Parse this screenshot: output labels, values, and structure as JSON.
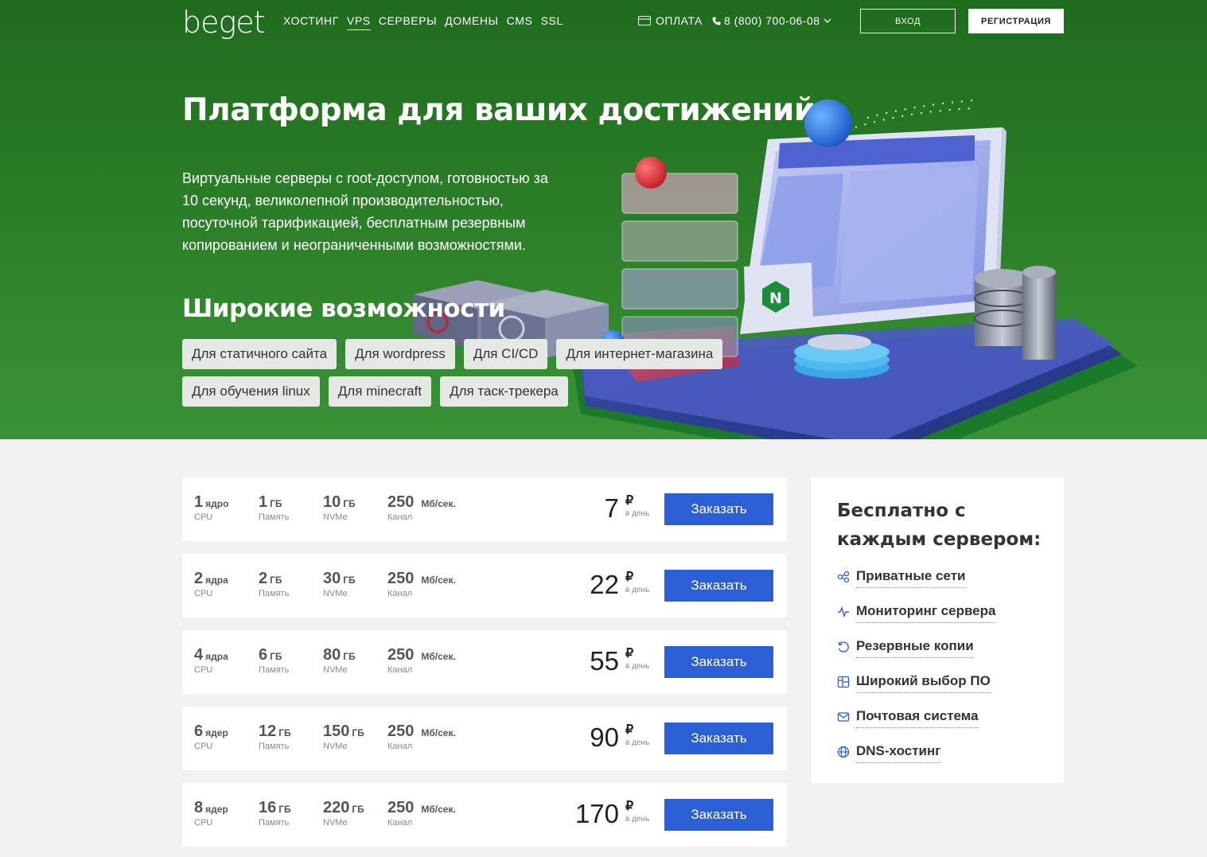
{
  "header": {
    "logo": "beget",
    "nav": [
      "ХОСТИНГ",
      "VPS",
      "СЕРВЕРЫ",
      "ДОМЕНЫ",
      "CMS",
      "SSL"
    ],
    "nav_active": "VPS",
    "payment_label": "ОПЛАТА",
    "phone": "8 (800) 700-06-08",
    "login_label": "ВХОД",
    "register_label": "РЕГИСТРАЦИЯ"
  },
  "hero": {
    "title": "Платформа для ваших достижений",
    "description": "Виртуальные серверы с root-доступом, готовностью за 10 секунд, великолепной производительностью, посуточной тарификацией, бесплатным резервным копированием и неограниченными возможностями.",
    "features_title": "Широкие возможности",
    "tags": [
      "Для статичного сайта",
      "Для wordpress",
      "Для CI/CD",
      "Для интернет-магазина",
      "Для обучения linux",
      "Для minecraft",
      "Для таск-трекера"
    ],
    "illustration_badge": "N"
  },
  "plans": [
    {
      "cpu": "1",
      "cpu_unit": "ядро",
      "ram": "1",
      "disk": "10",
      "channel": "250",
      "price": "7"
    },
    {
      "cpu": "2",
      "cpu_unit": "ядра",
      "ram": "2",
      "disk": "30",
      "channel": "250",
      "price": "22"
    },
    {
      "cpu": "4",
      "cpu_unit": "ядра",
      "ram": "6",
      "disk": "80",
      "channel": "250",
      "price": "55"
    },
    {
      "cpu": "6",
      "cpu_unit": "ядер",
      "ram": "12",
      "disk": "150",
      "channel": "250",
      "price": "90"
    },
    {
      "cpu": "8",
      "cpu_unit": "ядер",
      "ram": "16",
      "disk": "220",
      "channel": "250",
      "price": "170"
    }
  ],
  "plan_labels": {
    "cpu": "CPU",
    "ram": "Память",
    "disk": "NVMe",
    "channel": "Канал",
    "gb": "ГБ",
    "speed_unit": "Мб/сек.",
    "currency": "₽",
    "per_day": "в день",
    "order": "Заказать"
  },
  "free": {
    "title": "Бесплатно с каждым сервером:",
    "items": [
      {
        "label": "Приватные сети",
        "icon": "network-icon"
      },
      {
        "label": "Мониторинг сервера",
        "icon": "pulse-icon"
      },
      {
        "label": "Резервные копии",
        "icon": "backup-icon"
      },
      {
        "label": "Широкий выбор ПО",
        "icon": "software-icon"
      },
      {
        "label": "Почтовая система",
        "icon": "mail-icon"
      },
      {
        "label": "DNS-хостинг",
        "icon": "globe-icon"
      }
    ]
  },
  "colors": {
    "hero_green": "#2a7d27",
    "accent_blue": "#2a5fd6"
  }
}
